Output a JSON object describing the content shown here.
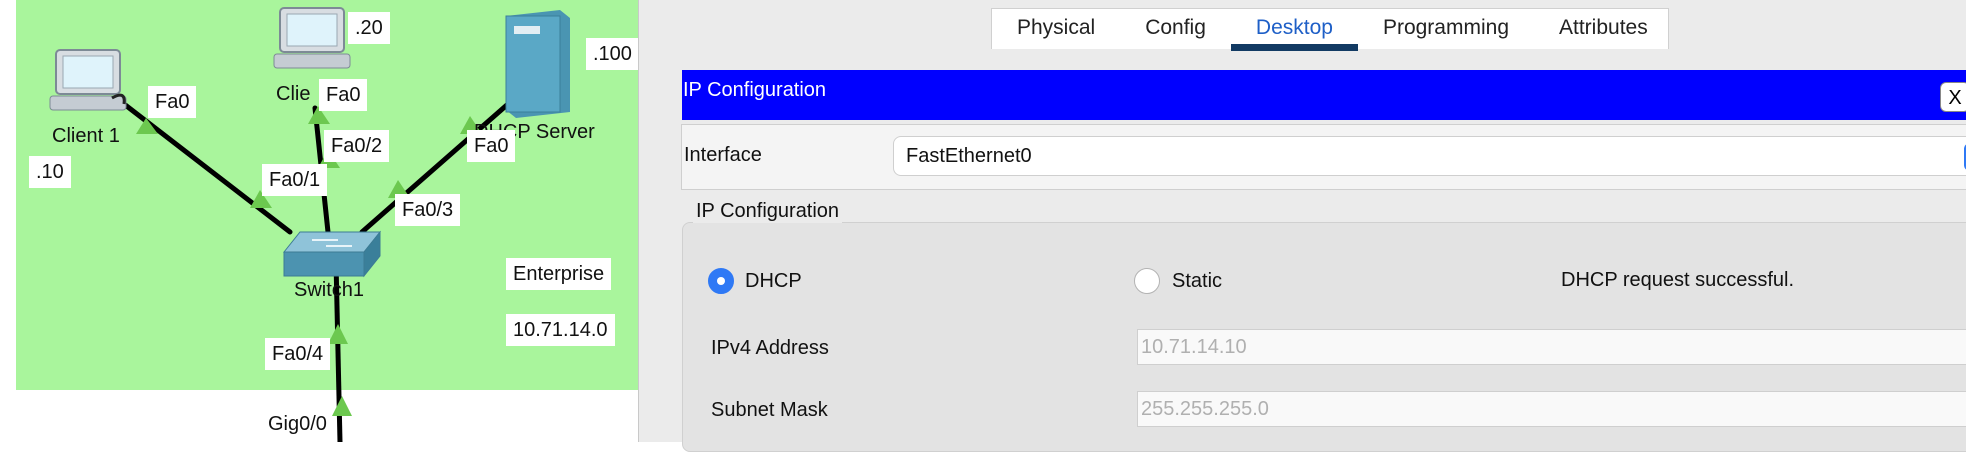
{
  "topology": {
    "devices": {
      "client1": {
        "name": "Client 1",
        "port": "Fa0",
        "ip_suffix": ".10"
      },
      "client2": {
        "name": "Clie",
        "port": "Fa0",
        "ip_suffix": ".20"
      },
      "server": {
        "name": "DHCP Server",
        "port": "Fa0",
        "ip_suffix": ".100"
      },
      "switch": {
        "name": "Switch1"
      }
    },
    "switch_ports": [
      "Fa0/1",
      "Fa0/2",
      "Fa0/3",
      "Fa0/4"
    ],
    "router_port": "Gig0/0",
    "network": {
      "name": "Enterprise",
      "address": "10.71.14.0"
    },
    "colors": {
      "zone": "#a9f59c",
      "link": "#000000",
      "link_marker": "#6cc84f"
    }
  },
  "tabs": {
    "items": [
      "Physical",
      "Config",
      "Desktop",
      "Programming",
      "Attributes"
    ],
    "active": "Desktop"
  },
  "ip_config": {
    "window_title": "IP Configuration",
    "close_label": "X",
    "interface_label": "Interface",
    "interface_value": "FastEthernet0",
    "section_title": "IP Configuration",
    "mode": {
      "dhcp_label": "DHCP",
      "static_label": "Static",
      "selected": "DHCP"
    },
    "status_text": "DHCP request successful.",
    "ipv4_label": "IPv4 Address",
    "ipv4_value": "10.71.14.10",
    "subnet_label": "Subnet Mask",
    "subnet_value": "255.255.255.0",
    "colors": {
      "title_bar": "#0000ff",
      "radio_selected": "#2f79f5",
      "tab_active_underline": "#123a63"
    }
  }
}
